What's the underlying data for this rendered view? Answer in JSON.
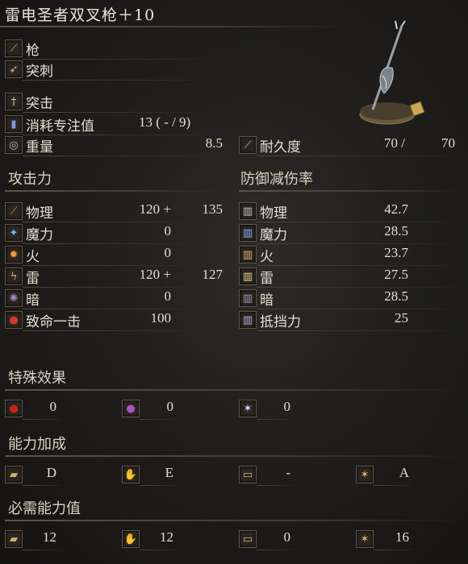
{
  "title": "雷电圣者双叉枪＋10",
  "weapon": {
    "type": "枪",
    "attack_type": "突刺",
    "skill": "突击",
    "fp_cost_label": "消耗专注值",
    "fp_cost_value": "13 (   - /  9)",
    "weight_label": "重量",
    "weight_value": "8.5",
    "durability_label": "耐久度",
    "durability_value": "70 /",
    "durability_max": "70"
  },
  "attack": {
    "heading": "攻击力",
    "rows": [
      {
        "label": "物理",
        "base": "120 +",
        "bonus": "135",
        "icon": "physical-icon"
      },
      {
        "label": "魔力",
        "base": "0",
        "bonus": "",
        "icon": "magic-icon"
      },
      {
        "label": "火",
        "base": "0",
        "bonus": "",
        "icon": "fire-icon"
      },
      {
        "label": "雷",
        "base": "120 +",
        "bonus": "127",
        "icon": "lightning-icon"
      },
      {
        "label": "暗",
        "base": "0",
        "bonus": "",
        "icon": "dark-icon"
      },
      {
        "label": "致命一击",
        "base": "100",
        "bonus": "",
        "icon": "critical-icon"
      }
    ]
  },
  "defense": {
    "heading": "防御减伤率",
    "rows": [
      {
        "label": "物理",
        "value": "42.7",
        "icon": "physical-guard-icon"
      },
      {
        "label": "魔力",
        "value": "28.5",
        "icon": "magic-guard-icon"
      },
      {
        "label": "火",
        "value": "23.7",
        "icon": "fire-guard-icon"
      },
      {
        "label": "雷",
        "value": "27.5",
        "icon": "lightning-guard-icon"
      },
      {
        "label": "暗",
        "value": "28.5",
        "icon": "dark-guard-icon"
      },
      {
        "label": "抵挡力",
        "value": "25",
        "icon": "stability-icon"
      }
    ]
  },
  "effects": {
    "heading": "特殊效果",
    "items": [
      {
        "icon": "bleed-icon",
        "value": "0"
      },
      {
        "icon": "poison-icon",
        "value": "0"
      },
      {
        "icon": "frost-icon",
        "value": "0"
      }
    ]
  },
  "scaling": {
    "heading": "能力加成",
    "items": [
      {
        "icon": "strength-icon",
        "value": "D"
      },
      {
        "icon": "dexterity-icon",
        "value": "E"
      },
      {
        "icon": "intelligence-icon",
        "value": "-"
      },
      {
        "icon": "faith-icon",
        "value": "A"
      }
    ]
  },
  "requirements": {
    "heading": "必需能力值",
    "items": [
      {
        "icon": "strength-icon",
        "value": "12"
      },
      {
        "icon": "dexterity-icon",
        "value": "12"
      },
      {
        "icon": "intelligence-icon",
        "value": "0"
      },
      {
        "icon": "faith-icon",
        "value": "16"
      }
    ]
  },
  "colors": {
    "background": "#1f1e1c",
    "text": "#e4ded1",
    "divider": "#5a5448"
  }
}
